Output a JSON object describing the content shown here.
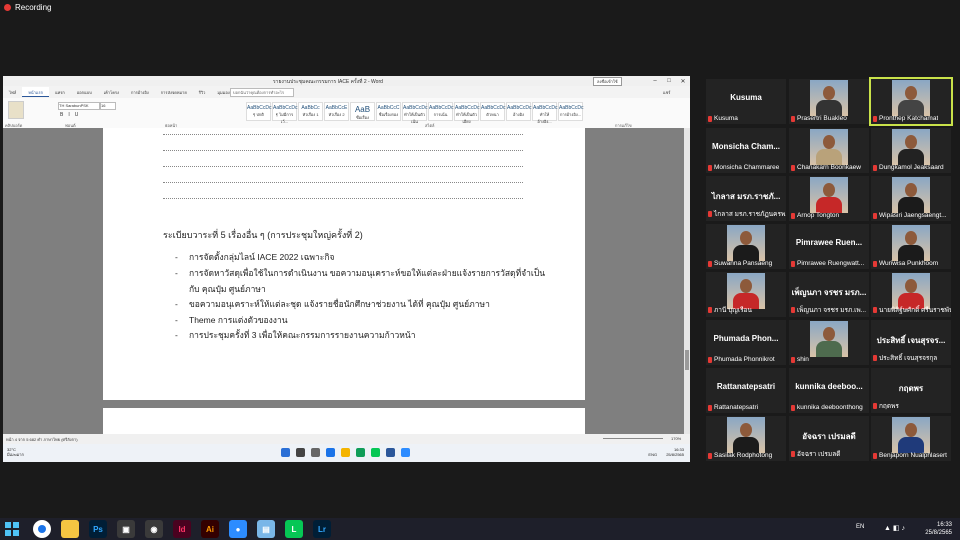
{
  "recording": {
    "label": "Recording"
  },
  "word": {
    "title": "รายงานประชุมคณะกรรมการ IACE ครั้งที่ 2 - Word",
    "account_button": "ลงชื่อเข้าใช้",
    "tabs": [
      "ไฟล์",
      "หน้าแรก",
      "แทรก",
      "ออกแบบ",
      "เค้าโครง",
      "การอ้างอิง",
      "การส่งจดหมาย",
      "รีวิว",
      "มุมมอง",
      "วิธีใช้"
    ],
    "active_tab": "หน้าแรก",
    "tell_me": "บอกฉันว่าคุณต้องการทำอะไร",
    "share": "แชร์",
    "font_name": "TH SarabunPSK",
    "font_size": "16",
    "styles": [
      {
        "preview": "AaBbCcDc",
        "name": "¶ ปกติ"
      },
      {
        "preview": "AaBbCcDc",
        "name": "¶ ไม่มีการเว้..."
      },
      {
        "preview": "AaBbCc",
        "name": "หัวเรื่อง 1"
      },
      {
        "preview": "AaBbCcE",
        "name": "หัวเรื่อง 2"
      },
      {
        "preview": "AaB",
        "name": "ชื่อเรื่อง"
      },
      {
        "preview": "AaBbCcC",
        "name": "ชื่อเรื่องรอง"
      },
      {
        "preview": "AaBbCcDc",
        "name": "ทำให้เป็นตัวเน้น"
      },
      {
        "preview": "AaBbCcDc",
        "name": "การเน้น"
      },
      {
        "preview": "AaBbCcDc",
        "name": "ทำให้เป็นตัวเอียง"
      },
      {
        "preview": "AaBbCcDc",
        "name": "ตัวหนา"
      },
      {
        "preview": "AaBbCcDc",
        "name": "อ้างอิง"
      },
      {
        "preview": "AaBbCcDc",
        "name": "ทำให้อ้างอิง..."
      },
      {
        "preview": "AaBbCcDc",
        "name": "การอ้างอิง..."
      }
    ],
    "ribbon_groups": [
      "คลิปบอร์ด",
      "ฟอนต์",
      "ย่อหน้า",
      "สไตล์",
      "การแก้ไข"
    ],
    "agenda_title": "ระเบียบวาระที่ 5 เรื่องอื่น ๆ (การประชุมใหญ่ครั้งที่ 2)",
    "bullets": [
      "การจัดตั้งกลุ่มไลน์ IACE 2022 เฉพาะกิจ",
      "การจัดหาวัสดุเพื่อใช้ในการดำเนินงาน ขอความอนุเคราะห์ขอให้แต่ละฝ่ายแจ้งรายการวัสดุที่จำเป็น",
      "กับ คุณปุ๋ม ศูนย์ภาษา",
      "ขอความอนุเคราะห์ให้แต่ละชุด แจ้งรายชื่อนักศึกษาช่วยงาน ได้ที่ คุณปุ๋ม ศูนย์ภาษา",
      "Theme การแต่งตัวของงาน",
      "การประชุมครั้งที่ 3 เพื่อให้คณะกรรมการรายงานความก้าวหน้า"
    ],
    "status_left": "หน้า 4 จาก 5   682 คำ   ภาษาไทย (ศรีลังกา)",
    "status_zoom": "170%",
    "weather_temp": "32°C",
    "weather_desc": "มีเมฆมาก",
    "tray_lang": "ENG",
    "tray_time": "16:33",
    "tray_date": "25/8/2565"
  },
  "participants": [
    {
      "display": "Kusuma",
      "label": "Kusuma",
      "video": false
    },
    {
      "display": "",
      "label": "Prasertri Buakleo",
      "video": true,
      "shirt": "#333"
    },
    {
      "display": "",
      "label": "Pronthep Katchamat",
      "video": true,
      "shirt": "#444",
      "active": true
    },
    {
      "display": "Monsicha  Cham...",
      "label": "Monsicha Chammaree",
      "video": false
    },
    {
      "display": "",
      "label": "Chanakarn Boonkaew",
      "video": true,
      "shirt": "#b9a27a"
    },
    {
      "display": "",
      "label": "Dungkamol Jeaksaard",
      "video": true,
      "shirt": "#222"
    },
    {
      "display": "ไกลาส มรภ.ราชภั...",
      "label": "ไกลาส มรภ.ราชภัฏนครพ...",
      "video": false
    },
    {
      "display": "",
      "label": "Arnop Tongton",
      "video": true,
      "shirt": "#c62828"
    },
    {
      "display": "",
      "label": "Wipasiri Jaengsaengt...",
      "video": true,
      "shirt": "#1b1b1b"
    },
    {
      "display": "",
      "label": "Suwanna Pansaeng",
      "video": true,
      "shirt": "#1b1b1b"
    },
    {
      "display": "Pimrawee  Ruen...",
      "label": "Pimrawee Ruengwatt...",
      "video": false
    },
    {
      "display": "",
      "label": "Wuriwisa Punkhoom",
      "video": true,
      "shirt": "#1b1b1b"
    },
    {
      "display": "",
      "label": "ภานี บุญเรือน",
      "video": true,
      "shirt": "#c62828"
    },
    {
      "display": "เพ็ญนภา จรชร มรภ...",
      "label": "เพ็ญนภา จรชร มรภ.เพ...",
      "video": false
    },
    {
      "display": "",
      "label": "นายพิสิฐ์ษศักดิ์ ศรีนราชพันธ์",
      "video": true,
      "shirt": "#c62828"
    },
    {
      "display": "Phumada  Phon...",
      "label": "Phumada Phonnikrot",
      "video": false
    },
    {
      "display": "",
      "label": "shin",
      "video": true,
      "shirt": "#4e6b4e"
    },
    {
      "display": "ประสิทธิ์ เจนสุรจร...",
      "label": "ประสิทธิ์ เจนสุรจรกุล",
      "video": false
    },
    {
      "display": "Rattanatepsatri",
      "label": "Rattanatepsatri",
      "video": false
    },
    {
      "display": "kunnika  deeboo...",
      "label": "kunnika deeboonthong",
      "video": false
    },
    {
      "display": "กฤดพร",
      "label": "กฤดพร",
      "video": false
    },
    {
      "display": "",
      "label": "Sasilak Rodphotong",
      "video": true,
      "shirt": "#1b1b1b"
    },
    {
      "display": "อัจฉรา เปรมลดี",
      "label": "อัจฉรา เปรมลดี",
      "video": false
    },
    {
      "display": "",
      "label": "Benjaporn Nualphlasert",
      "video": true,
      "shirt": "#1f3a7a"
    }
  ],
  "taskbar": {
    "apps": [
      "Chrome",
      "Explorer",
      "Ps",
      "Photos",
      "Media",
      "Id",
      "Ai",
      "Zoom",
      "Notepad",
      "LINE",
      "Lr"
    ],
    "lang": "EN",
    "time": "16:33",
    "date": "25/8/2565"
  },
  "colors": {
    "word_blue": "#2b579a",
    "active_speaker": "#c9e24a",
    "muted_mic": "#e53935",
    "taskbar": "#1e1f2a"
  }
}
